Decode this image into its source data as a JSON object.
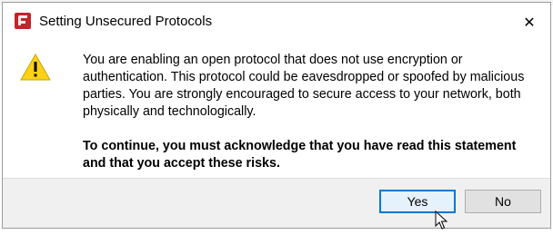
{
  "dialog": {
    "title": "Setting Unsecured Protocols",
    "close_glyph": "✕",
    "message": "You are enabling an open protocol that does not use encryption or authentication. This protocol could be eavesdropped or spoofed by malicious parties. You are strongly encouraged to secure access to your network, both physically and technologically.",
    "acknowledgement": "To continue, you must acknowledge that you have read this statement and that you accept these risks.",
    "buttons": {
      "yes": "Yes",
      "no": "No"
    }
  },
  "icons": {
    "app": "app-logo-icon",
    "warning": "warning-icon",
    "close": "close-icon",
    "cursor": "mouse-pointer-icon"
  },
  "colors": {
    "app_icon": "#c0252b",
    "warning_fill": "#fcd116",
    "default_button_border": "#0078d7"
  }
}
